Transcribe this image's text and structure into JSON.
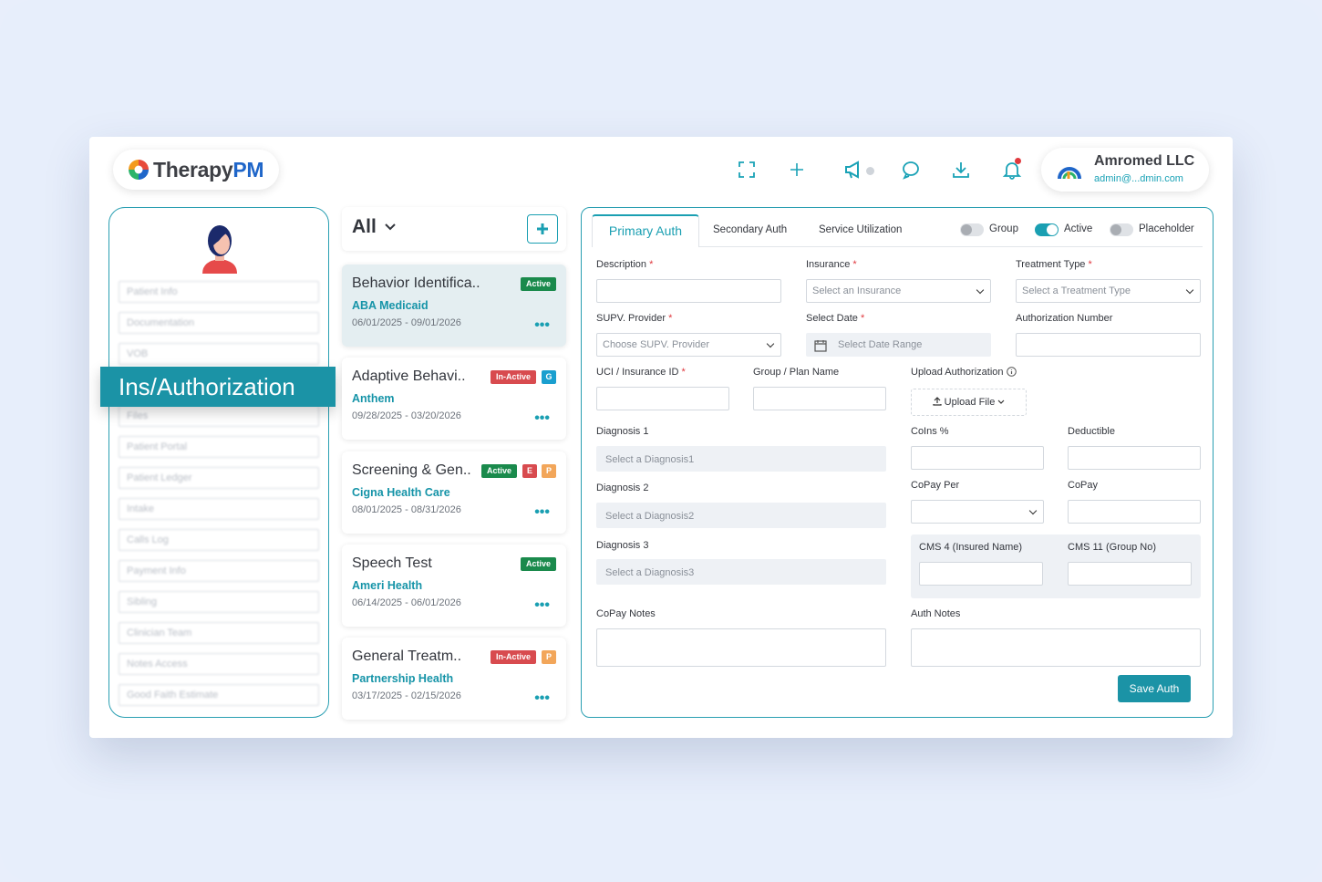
{
  "app": {
    "logo": {
      "name_prefix": "Therapy",
      "name_suffix": "PM"
    },
    "user": {
      "company": "Amromed LLC",
      "email": "admin@...dmin.com"
    },
    "header_icons": [
      "fullscreen-icon",
      "plus-icon",
      "megaphone-icon",
      "chat-icon",
      "download-icon",
      "bell-icon"
    ]
  },
  "sidebar": {
    "banner": "Ins/Authorization",
    "items": [
      "Patient Info",
      "Documentation",
      "VOB",
      "Files",
      "Patient Portal",
      "Patient Ledger",
      "Intake",
      "Calls Log",
      "Payment Info",
      "Sibling",
      "Clinician Team",
      "Notes Access",
      "Good Faith Estimate"
    ]
  },
  "list": {
    "filter": "All",
    "cards": [
      {
        "title": "Behavior Identifica..",
        "payer": "ABA  Medicaid",
        "dates": "06/01/2025 - 09/01/2026",
        "status": "Active",
        "tags": []
      },
      {
        "title": "Adaptive Behavi..",
        "payer": "Anthem",
        "dates": "09/28/2025 - 03/20/2026",
        "status": "In-Active",
        "tags": [
          "G"
        ]
      },
      {
        "title": "Screening & Gen..",
        "payer": "Cigna Health Care",
        "dates": "08/01/2025 - 08/31/2026",
        "status": "Active",
        "tags": [
          "E",
          "P"
        ]
      },
      {
        "title": "Speech Test",
        "payer": "Ameri Health",
        "dates": "06/14/2025 - 06/01/2026",
        "status": "Active",
        "tags": []
      },
      {
        "title": "General Treatm..",
        "payer": "Partnership Health",
        "dates": "03/17/2025 - 02/15/2026",
        "status": "In-Active",
        "tags": [
          "P"
        ]
      }
    ]
  },
  "form": {
    "tabs": [
      "Primary Auth",
      "Secondary Auth",
      "Service Utilization"
    ],
    "toggles": {
      "group": "Group",
      "active": "Active",
      "placeholder": "Placeholder"
    },
    "labels": {
      "description": "Description",
      "insurance": "Insurance",
      "treatment_type": "Treatment Type",
      "supv_provider": "SUPV. Provider",
      "select_date": "Select Date",
      "auth_number": "Authorization Number",
      "uci": "UCI / Insurance ID",
      "group_plan": "Group / Plan Name",
      "upload_auth": "Upload Authorization",
      "diagnosis1": "Diagnosis 1",
      "diagnosis2": "Diagnosis 2",
      "diagnosis3": "Diagnosis 3",
      "coins": "CoIns %",
      "deductible": "Deductible",
      "copay_per": "CoPay Per",
      "copay": "CoPay",
      "cms4": "CMS 4 (Insured Name)",
      "cms11": "CMS 11 (Group No)",
      "copay_notes": "CoPay Notes",
      "auth_notes": "Auth Notes"
    },
    "placeholders": {
      "insurance": "Select an Insurance",
      "treatment_type": "Select a Treatment Type",
      "supv_provider": "Choose SUPV. Provider",
      "date_range": "Select Date Range",
      "diagnosis1": "Select a Diagnosis1",
      "diagnosis2": "Select a Diagnosis2",
      "diagnosis3": "Select a Diagnosis3"
    },
    "upload_button": "Upload File",
    "save_button": "Save Auth"
  }
}
